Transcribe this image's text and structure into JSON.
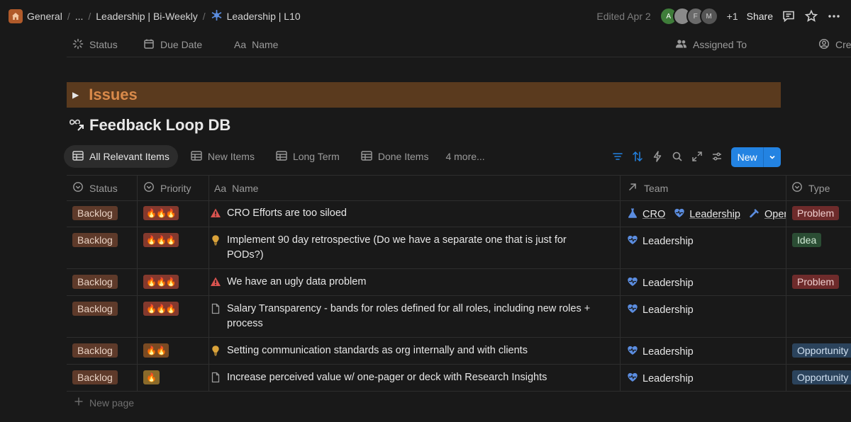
{
  "breadcrumbs": {
    "general": "General",
    "ellipsis": "...",
    "bi_weekly": "Leadership | Bi-Weekly",
    "l10": "Leadership | L10"
  },
  "topright": {
    "edited": "Edited Apr 2",
    "avatars": [
      "A",
      "",
      "F",
      "M"
    ],
    "plus_count": "+1",
    "share": "Share"
  },
  "page_props": {
    "status": "Status",
    "due_date": "Due Date",
    "name": "Name",
    "assigned_to": "Assigned To",
    "created": "Cre"
  },
  "issues_heading": "Issues",
  "db_title": "Feedback Loop DB",
  "tabs": [
    "All Relevant Items",
    "New Items",
    "Long Term",
    "Done Items"
  ],
  "more_tabs": "4 more...",
  "new_button": "New",
  "columns": {
    "status": "Status",
    "priority": "Priority",
    "name": "Name",
    "team": "Team",
    "type": "Type"
  },
  "rows": [
    {
      "status": "Backlog",
      "priority": "🔥🔥🔥",
      "icon": "warning-icon",
      "name": "CRO Efforts are too siloed",
      "teams": [
        "CRO",
        "Leadership",
        "Oper"
      ],
      "type": "Problem"
    },
    {
      "status": "Backlog",
      "priority": "🔥🔥🔥",
      "icon": "lightbulb-icon",
      "name": "Implement 90 day retrospective (Do we have a separate one that is just for PODs?)",
      "teams": [
        "Leadership"
      ],
      "type": "Idea"
    },
    {
      "status": "Backlog",
      "priority": "🔥🔥🔥",
      "icon": "warning-icon",
      "name": "We have an ugly data problem",
      "teams": [
        "Leadership"
      ],
      "type": "Problem"
    },
    {
      "status": "Backlog",
      "priority": "🔥🔥🔥",
      "icon": "document-icon",
      "name": "Salary Transparency - bands for roles defined for all roles, including new roles + process",
      "teams": [
        "Leadership"
      ],
      "type": ""
    },
    {
      "status": "Backlog",
      "priority": "🔥🔥",
      "icon": "lightbulb-icon",
      "name": "Setting communication standards as org internally and with clients",
      "teams": [
        "Leadership"
      ],
      "type": "Opportunity"
    },
    {
      "status": "Backlog",
      "priority": "🔥",
      "icon": "document-icon",
      "name": "Increase perceived value w/ one-pager or deck with Research Insights",
      "teams": [
        "Leadership"
      ],
      "type": "Opportunity"
    }
  ],
  "new_page": "New page",
  "colors": {
    "background": "#191919",
    "accent": "#2383e2",
    "issues_bar": "#5a3a1e",
    "issues_text": "#d98a4a"
  }
}
